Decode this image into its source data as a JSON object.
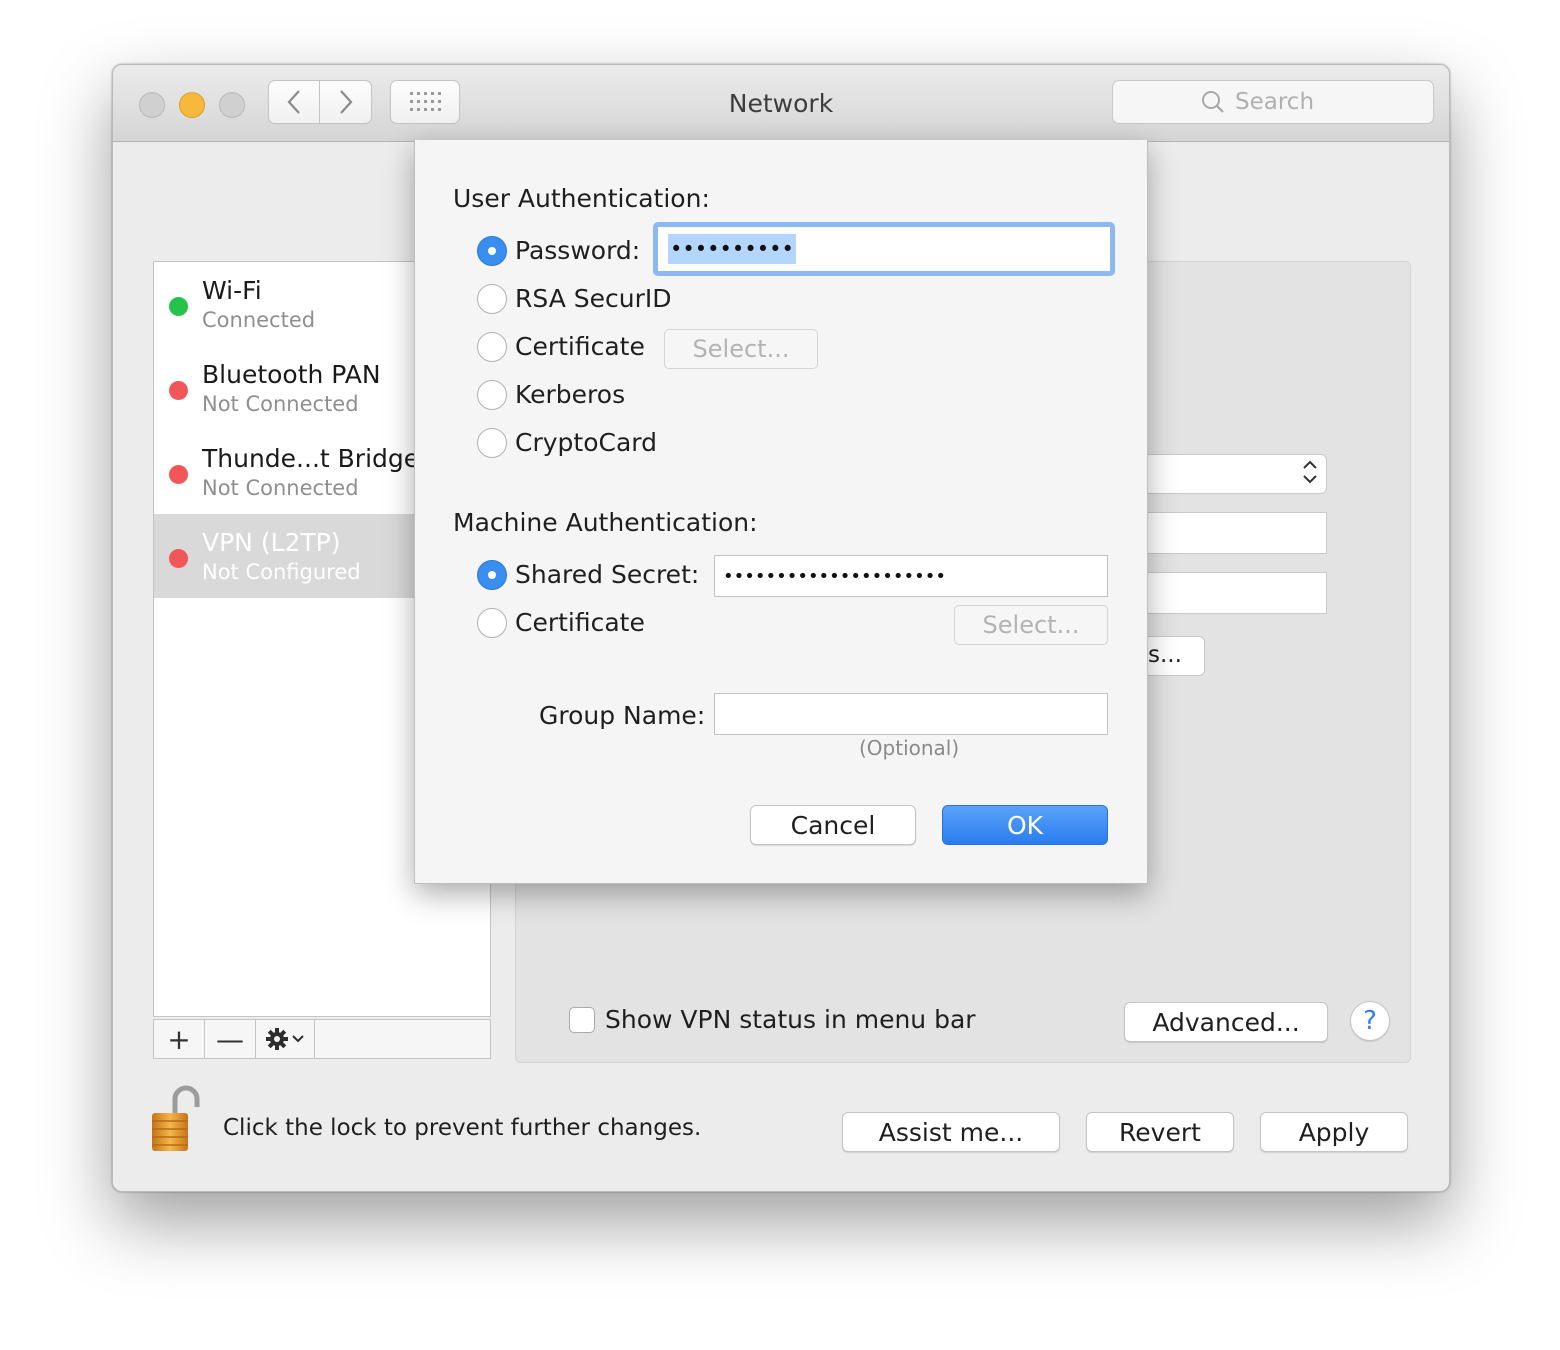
{
  "window": {
    "title": "Network",
    "search_placeholder": "Search"
  },
  "sidebar": {
    "services": [
      {
        "name": "Wi-Fi",
        "status": "Connected",
        "dot_color": "#27c24c"
      },
      {
        "name": "Bluetooth PAN",
        "status": "Not Connected",
        "dot_color": "#f25757"
      },
      {
        "name": "Thunde...t Bridge",
        "status": "Not Connected",
        "dot_color": "#f25757"
      },
      {
        "name": "VPN (L2TP)",
        "status": "Not Configured",
        "dot_color": "#f25757",
        "selected": true
      }
    ],
    "footer": {
      "add_label": "+",
      "remove_label": "—"
    }
  },
  "main": {
    "auth_settings_button_label": "s...",
    "show_vpn_status_label": "Show VPN status in menu bar",
    "show_vpn_status_checked": false,
    "advanced_label": "Advanced...",
    "help_label": "?"
  },
  "bottom": {
    "lock_text": "Click the lock to prevent further changes.",
    "assist_label": "Assist me...",
    "revert_label": "Revert",
    "apply_label": "Apply"
  },
  "sheet": {
    "user_auth_heading": "User Authentication:",
    "user_auth_options": [
      {
        "label": "Password:",
        "selected": true
      },
      {
        "label": "RSA SecurID",
        "selected": false
      },
      {
        "label": "Certificate",
        "selected": false
      },
      {
        "label": "Kerberos",
        "selected": false
      },
      {
        "label": "CryptoCard",
        "selected": false
      }
    ],
    "password_value": "••••••••••",
    "user_cert_select_label": "Select...",
    "machine_auth_heading": "Machine Authentication:",
    "machine_auth_options": [
      {
        "label": "Shared Secret:",
        "selected": true
      },
      {
        "label": "Certificate",
        "selected": false
      }
    ],
    "shared_secret_value": "•••••••••••••••••••••",
    "machine_cert_select_label": "Select...",
    "group_name_label": "Group Name:",
    "group_name_value": "",
    "optional_label": "(Optional)",
    "cancel_label": "Cancel",
    "ok_label": "OK"
  },
  "colors": {
    "accent_blue": "#2f7ff0",
    "selection_blue": "#b4d5fe",
    "status_green": "#27c24c",
    "status_red": "#f25757",
    "minimize_yellow": "#f6b93b"
  }
}
